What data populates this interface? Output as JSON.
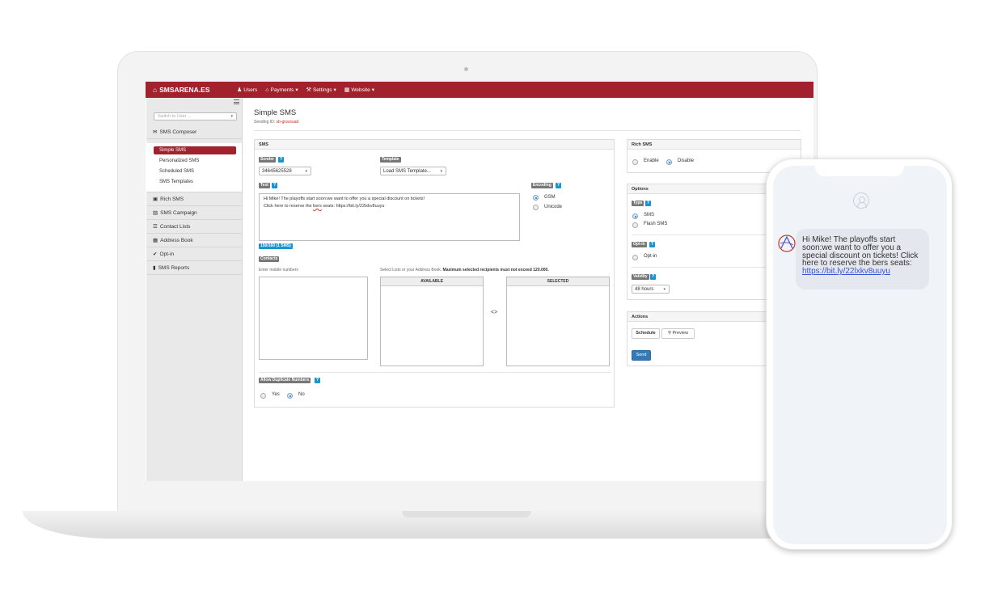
{
  "navbar": {
    "brand": "SMSARENA.ES",
    "items": [
      {
        "label": "Users",
        "icon": "user-icon"
      },
      {
        "label": "Payments",
        "icon": "bank-icon",
        "caret": true
      },
      {
        "label": "Settings",
        "icon": "wrench-icon",
        "caret": true
      },
      {
        "label": "Website",
        "icon": "grid-icon",
        "caret": true
      }
    ]
  },
  "sidebar": {
    "user_select_placeholder": "Switch to User ...",
    "composer_label": "SMS Composer",
    "sub_items": [
      "Simple SMS",
      "Personalized SMS",
      "Scheduled SMS",
      "SMS Templates"
    ],
    "sections": [
      "Rich SMS",
      "SMS Campaign",
      "Contact Lists",
      "Address Book",
      "Opt-in",
      "SMS Reports"
    ]
  },
  "page": {
    "title": "Simple SMS",
    "sending_id_label": "Sending ID:",
    "sending_id_value": "sb-gnarsuad"
  },
  "sms_panel": {
    "heading": "SMS",
    "sender_label": "Sender",
    "sender_value": "34645625528",
    "template_label": "Template",
    "template_value": "Load SMS Template...",
    "text_label": "Text",
    "text_line1": "Hi Mike! The playoffs start soon:we want to offer you a special discount on tickets!",
    "text_line2_a": "Click here to reserve the ",
    "text_line2_err": "bers",
    "text_line2_b": " seats: https://bit.ly/22lxkv8uuyu",
    "counter": "150/160 (1 SMS)",
    "encoding_label": "Encoding",
    "encoding_options": [
      "GSM",
      "Unicode"
    ],
    "contacts_label": "Contacts",
    "mobile_hint": "Enter mobile numbers",
    "lists_hint": "Select Lists or your Address Book.",
    "lists_hint_bold": "Maximum selected recipients must not exceed 120.000.",
    "available_label": "AVAILABLE",
    "selected_label": "SELECTED",
    "transfer_symbol": "<>",
    "duplicates_label": "Allow Duplicate Numbers",
    "duplicates_options": [
      "Yes",
      "No"
    ]
  },
  "rich_panel": {
    "heading": "Rich SMS",
    "options": [
      "Enable",
      "Disable"
    ]
  },
  "options_panel": {
    "heading": "Options",
    "type_label": "Type",
    "type_options": [
      "SMS",
      "Flash SMS"
    ],
    "optin_label": "Opt-in",
    "optin_option": "Opt-in",
    "validity_label": "Validity",
    "validity_value": "48 hours"
  },
  "actions_panel": {
    "heading": "Actions",
    "schedule": "Schedule",
    "preview": "Preview",
    "send": "Send"
  },
  "phone": {
    "message_text": "Hi Mike! The playoffs start soon:we want to offer you a special discount on tickets! Click here to reserve the bers seats: ",
    "message_link": "https://bit.ly/22lxkv8uuyu"
  },
  "colors": {
    "brand_red": "#a1212c",
    "help_blue": "#1a94d0",
    "primary_blue": "#337ab7"
  }
}
